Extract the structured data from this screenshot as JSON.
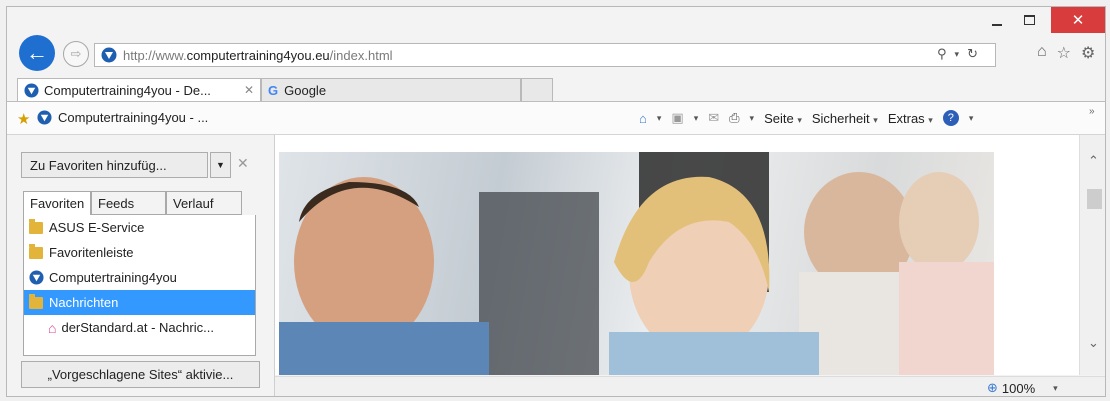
{
  "window": {
    "close_glyph": "✕"
  },
  "address_bar": {
    "url_prefix": "http://www.",
    "url_domain": "computertraining4you.eu",
    "url_suffix": "/index.html"
  },
  "tabs": [
    {
      "label": "Computertraining4you - De...",
      "active": true
    },
    {
      "label": "Google",
      "active": false
    }
  ],
  "command_bar": {
    "page_title": "Computertraining4you - ...",
    "menus": [
      "Seite",
      "Sicherheit",
      "Extras"
    ]
  },
  "favorites_pane": {
    "add_button": "Zu Favoriten hinzufüg...",
    "tabs": [
      "Favoriten",
      "Feeds",
      "Verlauf"
    ],
    "items": [
      {
        "label": "ASUS E-Service",
        "icon": "folder-icon"
      },
      {
        "label": "Favoritenleiste",
        "icon": "folder-icon"
      },
      {
        "label": "Computertraining4you",
        "icon": "site-icon"
      },
      {
        "label": "Nachrichten",
        "icon": "folder-icon",
        "selected": true
      },
      {
        "label": "derStandard.at - Nachric...",
        "icon": "house-icon"
      }
    ],
    "suggest_button": "„Vorgeschlagene Sites“ aktivie..."
  },
  "status_bar": {
    "zoom": "100%"
  },
  "colors": {
    "accent": "#1f6fd1",
    "selection": "#3399ff",
    "close": "#d83c3c"
  }
}
